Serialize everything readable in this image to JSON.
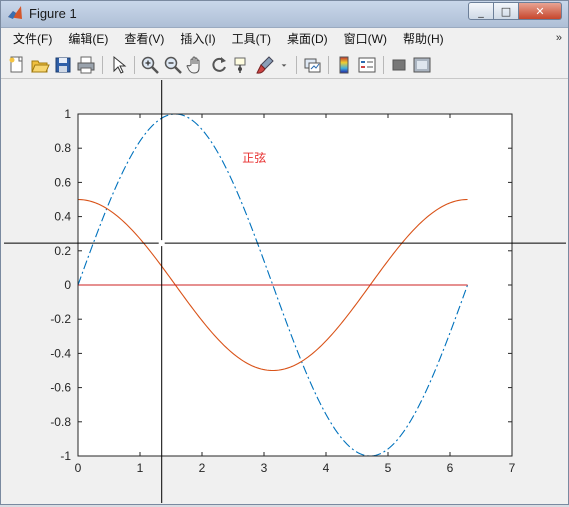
{
  "window": {
    "title": "Figure 1",
    "controls": {
      "minimize": "_",
      "maximize": "□",
      "close": "✕"
    }
  },
  "menubar": {
    "items": [
      "文件(F)",
      "编辑(E)",
      "查看(V)",
      "插入(I)",
      "工具(T)",
      "桌面(D)",
      "窗口(W)",
      "帮助(H)"
    ],
    "overflow_icon": "double-chevron-icon"
  },
  "toolbar": {
    "tools": [
      "new-figure-icon",
      "open-icon",
      "save-icon",
      "print-icon",
      "|",
      "pointer-icon",
      "|",
      "zoom-in-icon",
      "zoom-out-icon",
      "pan-icon",
      "rotate-icon",
      "data-cursor-icon",
      "brush-icon",
      "dropdown-arrow-icon",
      "|",
      "link-plot-icon",
      "|",
      "colorbar-icon",
      "legend-icon",
      "|",
      "hide-plot-tools-icon",
      "show-plot-tools-icon"
    ]
  },
  "chart_data": {
    "type": "line",
    "title": "",
    "xlabel": "",
    "ylabel": "",
    "xlim": [
      0,
      7
    ],
    "ylim": [
      -1,
      1
    ],
    "xticks": [
      "0",
      "1",
      "2",
      "3",
      "4",
      "5",
      "6",
      "7"
    ],
    "yticks": [
      "-1",
      "-0.8",
      "-0.6",
      "-0.4",
      "-0.2",
      "0",
      "0.2",
      "0.4",
      "0.6",
      "0.8",
      "1"
    ],
    "grid": false,
    "x_range": [
      0,
      6.2832
    ],
    "series": [
      {
        "expression": "sin(x)",
        "style": "dash-dot",
        "color": "#0072bd"
      },
      {
        "expression": "0.5*cos(x)",
        "style": "solid",
        "color": "#d95319"
      },
      {
        "expression": "0",
        "style": "solid",
        "color": "#cc2222"
      }
    ],
    "annotation": {
      "text": "正弦",
      "x": 2.65,
      "y": 0.72,
      "color": "#e83030"
    },
    "crosshair": {
      "x": 1.35,
      "y": 0.245,
      "color": "#000000"
    }
  }
}
